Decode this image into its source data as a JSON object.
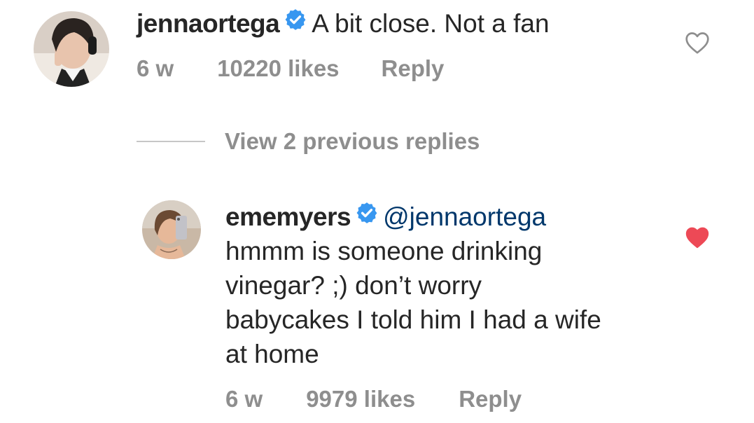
{
  "comment": {
    "username": "jennaortega",
    "text": "A bit close. Not a fan",
    "time": "6 w",
    "likes": "10220 likes",
    "reply_label": "Reply",
    "liked": false
  },
  "view_replies": {
    "label": "View 2 previous replies"
  },
  "reply": {
    "username": "ememyers",
    "mention": "@jennaortega",
    "lines": [
      "hmmm is someone drinking",
      "vinegar? ;) don’t worry",
      "babycakes I told him I had a wife",
      "at home"
    ],
    "time": "6 w",
    "likes": "9979 likes",
    "reply_label": "Reply",
    "liked": true
  },
  "colors": {
    "verified_badge": "#3897f0",
    "liked_heart": "#ed4956",
    "muted_text": "#8e8e8e",
    "mention": "#00376b"
  },
  "icons": {
    "verified": "verified-badge-icon",
    "heart_outline": "heart-outline-icon",
    "heart_filled": "heart-filled-icon"
  }
}
